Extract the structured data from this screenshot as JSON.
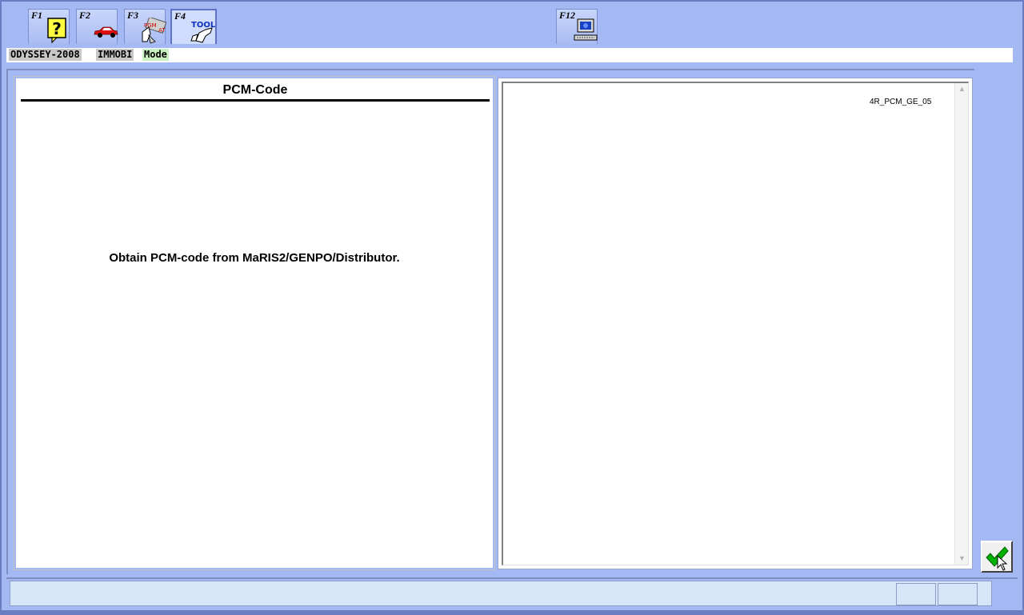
{
  "toolbar": {
    "keys": [
      {
        "label": "F1",
        "icon": "help-icon"
      },
      {
        "label": "F2",
        "icon": "car-icon"
      },
      {
        "label": "F3",
        "icon": "pgm-fi-at-icon"
      },
      {
        "label": "F4",
        "icon": "tool-icon"
      },
      {
        "label": "F12",
        "icon": "computer-icon"
      }
    ]
  },
  "breadcrumb": {
    "model": "ODYSSEY-2008",
    "system": "IMMOBI",
    "mode": "Mode"
  },
  "left_panel": {
    "title": "PCM-Code",
    "message": "Obtain PCM-code from MaRIS2/GENPO/Distributor."
  },
  "right_panel": {
    "code_label": "4R_PCM_GE_05"
  },
  "f3_icon_text": {
    "pgm": "PGM",
    "at": "AT"
  },
  "f4_icon_text": "TOOL",
  "colors": {
    "background": "#a4b8f4",
    "status_bar": "#d6e5f7",
    "mode_badge": "#c8f0c0",
    "ok_check": "#00b000"
  }
}
